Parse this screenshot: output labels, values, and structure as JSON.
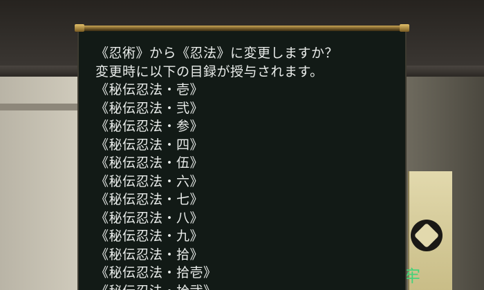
{
  "dialog": {
    "question": "《忍術》から《忍法》に変更しますか？",
    "notice": "変更時に以下の目録が授与されます。",
    "items": [
      "《秘伝忍法・壱》",
      "《秘伝忍法・弐》",
      "《秘伝忍法・参》",
      "《秘伝忍法・四》",
      "《秘伝忍法・伍》",
      "《秘伝忍法・六》",
      "《秘伝忍法・七》",
      "《秘伝忍法・八》",
      "《秘伝忍法・九》",
      "《秘伝忍法・拾》",
      "《秘伝忍法・拾壱》",
      "《秘伝忍法・拾弐》"
    ]
  },
  "scene": {
    "banner_glyph": "牢"
  },
  "colors": {
    "dialog_bg": "#121a16",
    "text": "#e9ecea",
    "rod_gold": "#c9a655"
  }
}
